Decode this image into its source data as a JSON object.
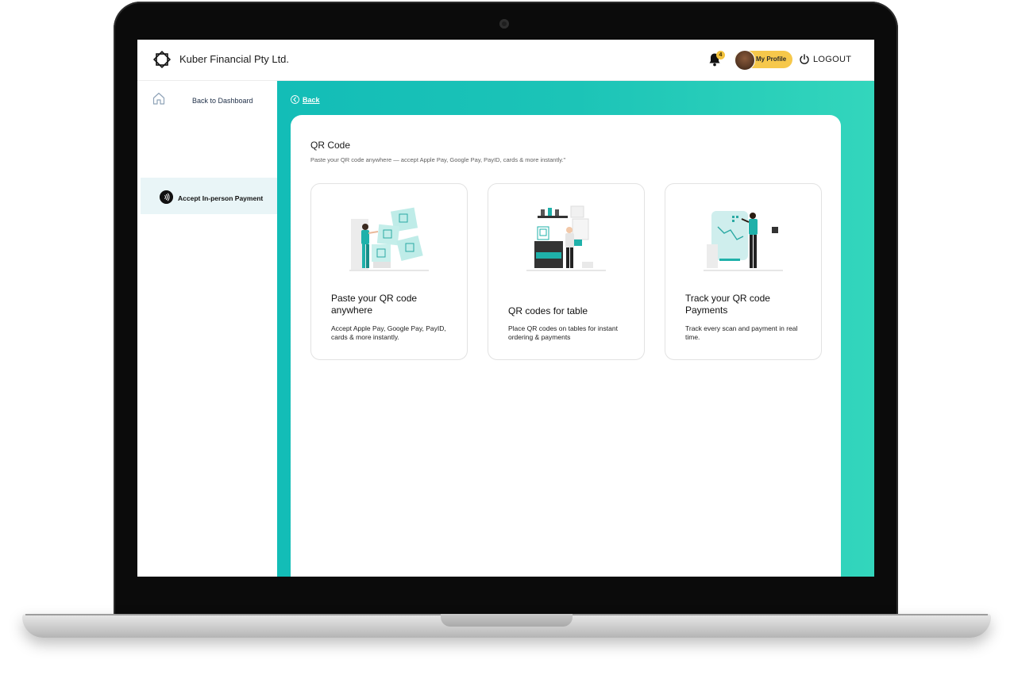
{
  "app": {
    "brand": "Kuber Financial Pty Ltd.",
    "notification_count": "4",
    "profile_label": "My Profile",
    "logout_label": "LOGOUT"
  },
  "sidebar": {
    "back_label": "Back to Dashboard",
    "items": [
      {
        "label": "Accept In-person Payment",
        "active": true,
        "icon": "nfc-icon"
      }
    ]
  },
  "main": {
    "back_label": "Back",
    "title": "QR Code",
    "subtitle": "Paste your QR code anywhere — accept Apple Pay, Google Pay, PayID, cards & more instantly.\"",
    "options": [
      {
        "title": "Paste your QR code anywhere",
        "description": "Accept Apple Pay, Google Pay, PayID, cards & more instantly.",
        "illustration": "person-with-qr-codes"
      },
      {
        "title": "QR codes for table",
        "description": "Place QR codes on tables for instant ordering & payments",
        "illustration": "shop-counter-qr"
      },
      {
        "title": "Track your QR code Payments",
        "description": "Track every scan and payment in real time.",
        "illustration": "person-with-chart"
      }
    ]
  },
  "colors": {
    "accent": "#1cc4b7",
    "accent_light": "#33d6bc",
    "badge": "#f3c33d",
    "profile_pill": "#f6c84b",
    "sidebar_active": "#e9f5f7"
  }
}
